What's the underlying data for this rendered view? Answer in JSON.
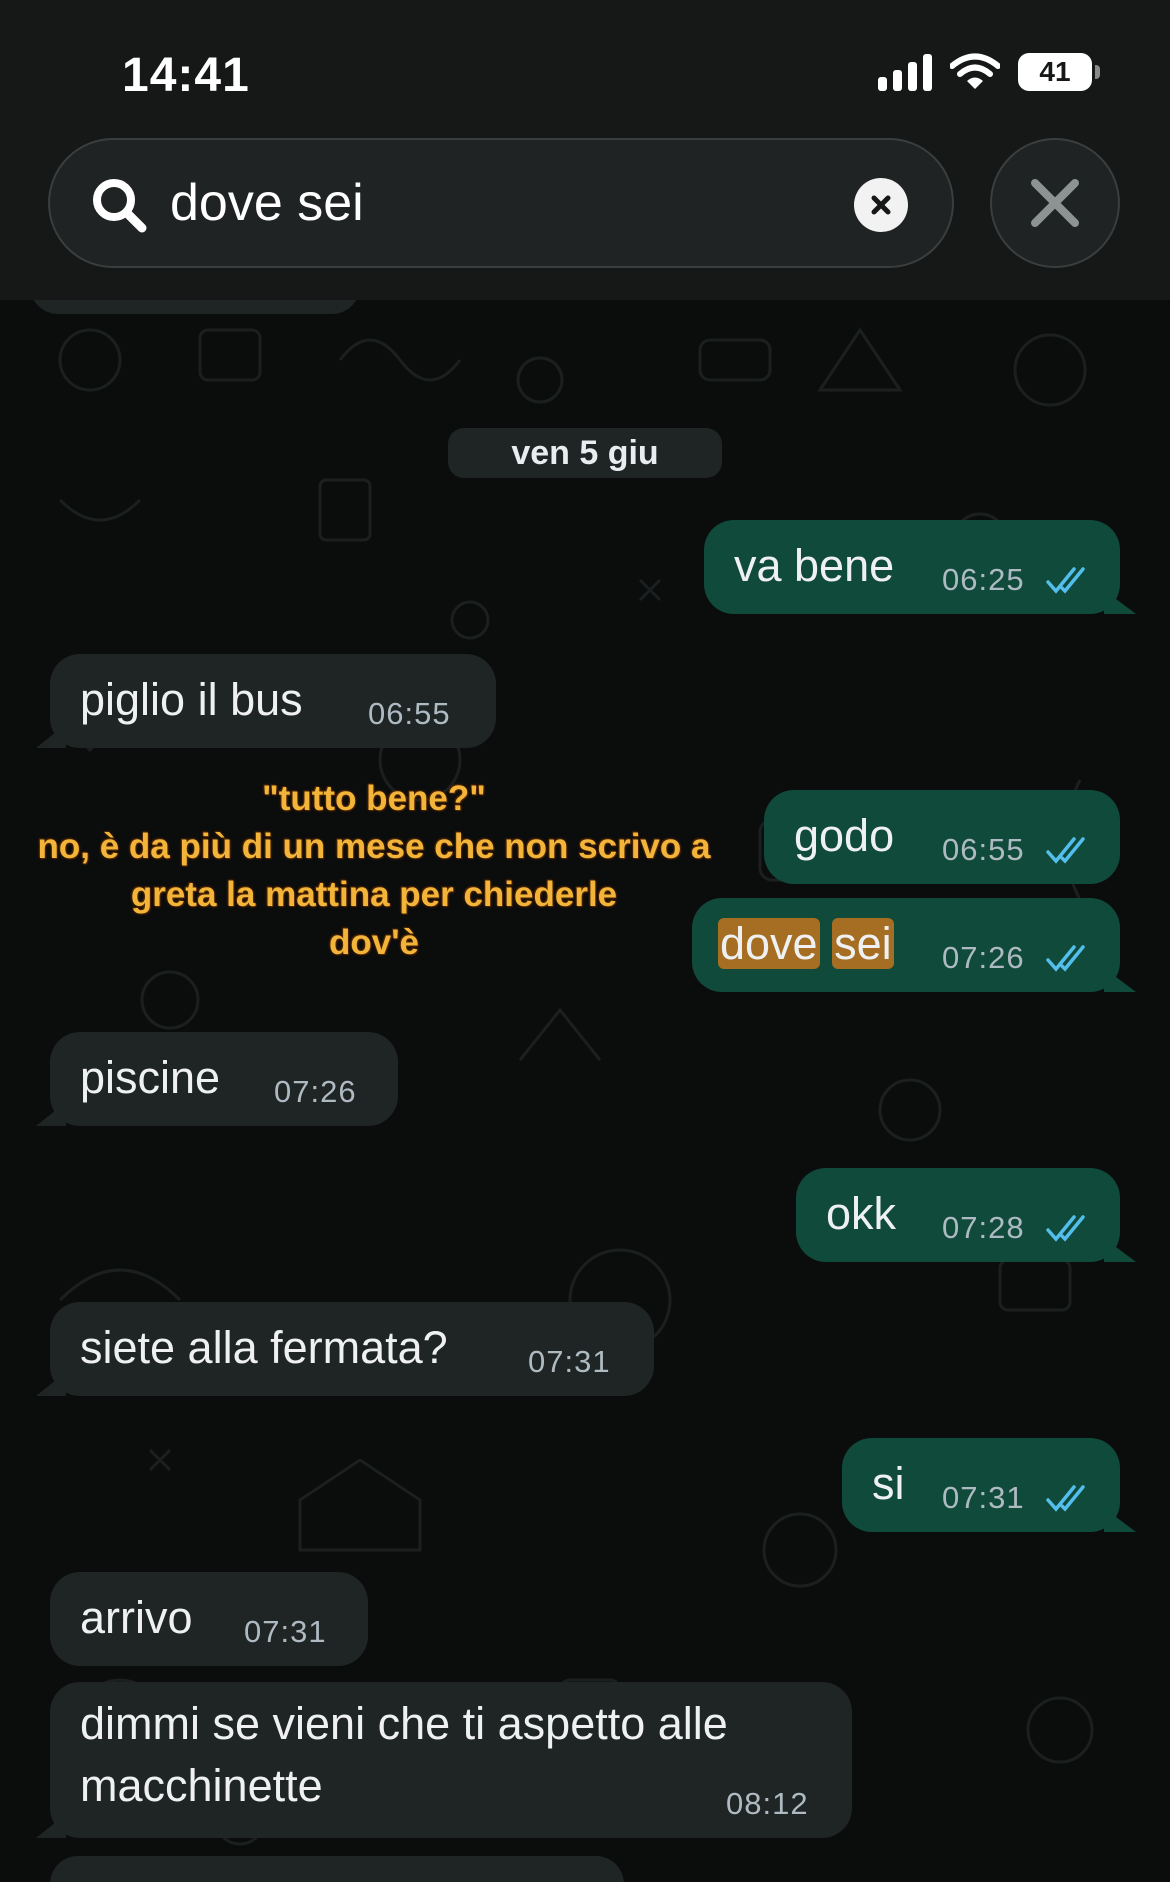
{
  "status_bar": {
    "time": "14:41",
    "battery": "41"
  },
  "search": {
    "query": "dove sei"
  },
  "date_divider": "ven 5 giu",
  "messages": [
    {
      "dir": "out",
      "text": "va bene",
      "time": "06:25"
    },
    {
      "dir": "in",
      "text": "piglio il bus",
      "time": "06:55"
    },
    {
      "dir": "out",
      "text": "godo",
      "time": "06:55"
    },
    {
      "dir": "out",
      "text": "dove sei",
      "highlight": [
        "dove",
        "sei"
      ],
      "time": "07:26"
    },
    {
      "dir": "in",
      "text": "piscine",
      "time": "07:26"
    },
    {
      "dir": "out",
      "text": "okk",
      "time": "07:28"
    },
    {
      "dir": "in",
      "text": "siete alla fermata?",
      "time": "07:31"
    },
    {
      "dir": "out",
      "text": "si",
      "time": "07:31"
    },
    {
      "dir": "in",
      "text": "arrivo",
      "time": "07:31"
    },
    {
      "dir": "in",
      "text_lines": [
        "dimmi se vieni che ti aspetto alle",
        "macchinette"
      ],
      "time": "08:12"
    }
  ],
  "caption": {
    "lines": [
      "\"tutto bene?\"",
      "no, è da più di un mese che non scrivo a",
      "greta la mattina per chiederle",
      "dov'è"
    ]
  },
  "colors": {
    "outgoing_bubble": "#0f4a3a",
    "incoming_bubble": "#1f2424",
    "read_ticks": "#53bdeb",
    "search_highlight": "#a56e22",
    "caption_text": "#f2b53a"
  },
  "icons": [
    "search-icon",
    "clear-search-icon",
    "close-icon",
    "signal-icon",
    "wifi-icon",
    "battery-icon",
    "read-ticks-icon"
  ]
}
